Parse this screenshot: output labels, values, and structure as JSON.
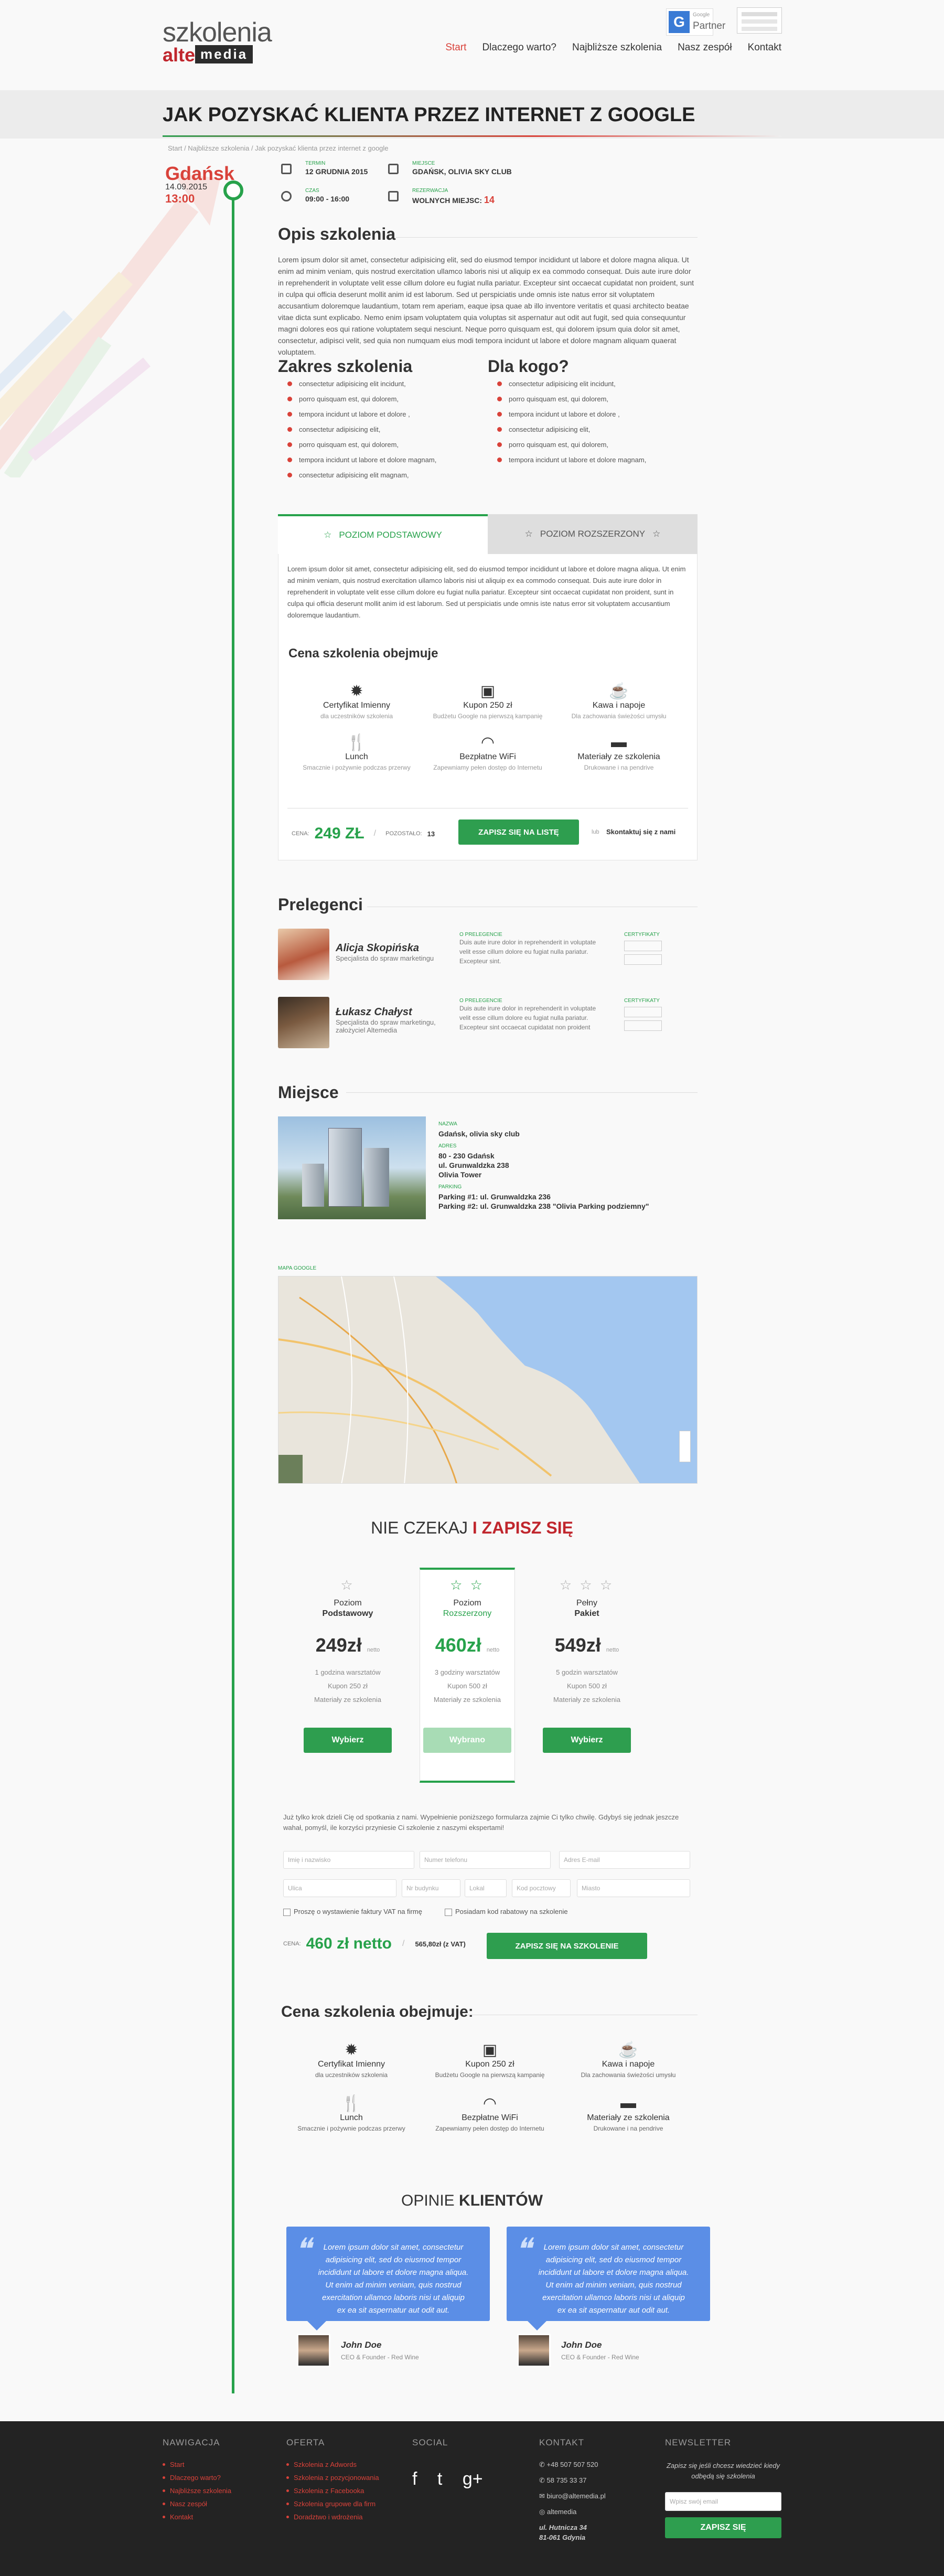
{
  "header": {
    "logo_top": "szkolenia",
    "logo_left": "alte",
    "logo_right": "media",
    "partner_letter": "G",
    "partner_small": "Google",
    "partner_label": "Partner",
    "nav": [
      "Start",
      "Dlaczego warto?",
      "Najbliższe szkolenia",
      "Nasz zespół",
      "Kontakt"
    ]
  },
  "page": {
    "title": "JAK POZYSKAĆ KLIENTA PRZEZ INTERNET Z GOOGLE",
    "breadcrumb": "Start  /  Najbliższe szkolenia  /  Jak pozyskać klienta przez internet z google"
  },
  "event": {
    "city": "Gdańsk",
    "date": "14.09.2015",
    "time": "13:00",
    "termin_label": "TERMIN",
    "termin": "12 GRUDNIA 2015",
    "miejsce_label": "MIEJSCE",
    "miejsce": "GDAŃSK, OLIVIA SKY CLUB",
    "czas_label": "CZAS",
    "czas": "09:00 - 16:00",
    "rezerwacja_label": "REZERWACJA",
    "rezerwacja": "WOLNYCH MIEJSC:",
    "wolne": "14"
  },
  "opis": {
    "title": "Opis szkolenia",
    "text": "Lorem ipsum dolor sit amet, consectetur adipisicing elit, sed do eiusmod tempor incididunt ut labore et dolore magna aliqua. Ut enim ad minim veniam, quis nostrud exercitation ullamco laboris nisi ut aliquip ex ea commodo consequat. Duis aute irure dolor in reprehenderit in voluptate velit esse cillum dolore eu fugiat nulla pariatur. Excepteur sint occaecat cupidatat non proident, sunt in culpa qui officia deserunt mollit anim id est laborum. Sed ut perspiciatis unde omnis iste natus error sit voluptatem accusantium doloremque laudantium, totam rem aperiam, eaque ipsa quae ab illo inventore veritatis et quasi architecto beatae vitae dicta sunt explicabo. Nemo enim ipsam voluptatem quia voluptas sit aspernatur aut odit aut fugit, sed quia consequuntur magni dolores eos qui ratione voluptatem sequi nesciunt. Neque porro quisquam est, qui dolorem ipsum quia dolor sit amet, consectetur, adipisci velit, sed quia non numquam eius modi tempora incidunt ut labore et dolore magnam aliquam quaerat voluptatem."
  },
  "zakres": {
    "title": "Zakres szkolenia",
    "items": [
      "consectetur adipisicing elit incidunt,",
      "porro quisquam est, qui dolorem,",
      "tempora incidunt ut labore et dolore ,",
      "consectetur adipisicing elit,",
      "porro quisquam est, qui dolorem,",
      "tempora incidunt ut labore et dolore magnam,",
      "consectetur adipisicing elit magnam,"
    ]
  },
  "dlakogo": {
    "title": "Dla kogo?",
    "items": [
      "consectetur adipisicing elit incidunt,",
      "porro quisquam est, qui dolorem,",
      "tempora incidunt ut labore et dolore ,",
      "consectetur adipisicing elit,",
      "porro quisquam est, qui dolorem,",
      "tempora incidunt ut labore et dolore magnam,"
    ]
  },
  "tabs": {
    "tab1": "POZIOM PODSTAWOWY",
    "tab2": "POZIOM ROZSZERZONY",
    "text": "Lorem ipsum dolor sit amet, consectetur adipisicing elit, sed do eiusmod tempor incididunt ut labore et dolore magna aliqua. Ut enim ad minim veniam, quis nostrud exercitation ullamco laboris nisi ut aliquip ex ea commodo consequat. Duis aute irure dolor in reprehenderit in voluptate velit esse cillum dolore eu fugiat nulla pariatur. Excepteur sint occaecat cupidatat non proident, sunt in culpa qui officia deserunt mollit anim id est laborum. Sed ut perspiciatis unde omnis iste natus error sit voluptatem accusantium doloremque laudantium.",
    "obejmuje": "Cena szkolenia obejmuje",
    "features": [
      {
        "t": "Certyfikat Imienny",
        "s": "dla uczestników szkolenia",
        "icon": "certificate-icon"
      },
      {
        "t": "Kupon 250 zł",
        "s": "Budżetu Google na pierwszą kampanię",
        "icon": "coupon-icon"
      },
      {
        "t": "Kawa i napoje",
        "s": "Dla zachowania świeżości umysłu",
        "icon": "coffee-icon"
      },
      {
        "t": "Lunch",
        "s": "Smacznie i pożywnie podczas przerwy",
        "icon": "lunch-icon"
      },
      {
        "t": "Bezpłatne WiFi",
        "s": "Zapewniamy pełen dostęp do Internetu",
        "icon": "wifi-icon"
      },
      {
        "t": "Materiały ze szkolenia",
        "s": "Drukowane i na pendrive",
        "icon": "folder-icon"
      }
    ],
    "cena_label": "CENA:",
    "cena": "249 ZŁ",
    "pozostalo_label": "POZOSTAŁO:",
    "pozostalo": "13",
    "button": "ZAPISZ SIĘ NA LISTĘ",
    "lub": "lub",
    "skontaktuj": "Skontaktuj się z nami"
  },
  "prelegenci": {
    "title": "Prelegenci",
    "o_label": "O PRELEGENCIE",
    "cert_label": "CERTYFIKATY",
    "list": [
      {
        "name": "Alicja Skopińska",
        "role": "Specjalista do spraw marketingu",
        "text": "Duis aute irure dolor in reprehenderit in voluptate velit esse cillum dolore eu fugiat nulla pariatur. Excepteur sint."
      },
      {
        "name": "Łukasz Chałyst",
        "role": "Specjalista do spraw marketingu, założyciel Altemedia",
        "text": "Duis aute irure dolor in reprehenderit in voluptate velit esse cillum dolore eu fugiat nulla pariatur. Excepteur sint occaecat cupidatat non proident"
      }
    ]
  },
  "miejsce": {
    "title": "Miejsce",
    "nazwa_label": "NAZWA",
    "nazwa": "Gdańsk, olivia sky club",
    "adres_label": "ADRES",
    "adres1": "80 - 230 Gdańsk",
    "adres2": "ul. Grunwaldzka 238",
    "adres3": "Olivia Tower",
    "parking_label": "PARKING",
    "parking1": "Parking #1: ul. Grunwaldzka 236",
    "parking2": "Parking #2: ul. Grunwaldzka 238 \"Olivia Parking podziemny\"",
    "map_label": "MAPA GOOGLE"
  },
  "pricing": {
    "title_a": "NIE CZEKAJ",
    "title_b": "I ZAPISZ SIĘ",
    "cards": [
      {
        "stars": "☆",
        "name1": "Poziom",
        "name2": "Podstawowy",
        "price": "249zł",
        "suffix": "netto",
        "f": [
          "1 godzina warsztatów",
          "Kupon 250 zł",
          "Materiały ze szkolenia"
        ],
        "button": "Wybierz"
      },
      {
        "stars": "☆ ☆",
        "name1": "Poziom",
        "name2": "Rozszerzony",
        "price": "460zł",
        "suffix": "netto",
        "f": [
          "3 godziny warsztatów",
          "Kupon 500 zł",
          "Materiały ze szkolenia"
        ],
        "button": "Wybrano"
      },
      {
        "stars": "☆ ☆ ☆",
        "name1": "Pełny",
        "name2": "Pakiet",
        "price": "549zł",
        "suffix": "netto",
        "f": [
          "5 godzin warsztatów",
          "Kupon 500 zł",
          "Materiały ze szkolenia"
        ],
        "button": "Wybierz"
      }
    ]
  },
  "form": {
    "intro": "Już tylko krok dzieli Cię od spotkania z nami. Wypełnienie poniższego formularza zajmie Ci tylko chwilę. Gdybyś się jednak jeszcze wahał, pomyśl, ile korzyści przyniesie Ci szkolenie z naszymi ekspertami!",
    "ph_name": "Imię i nazwisko",
    "ph_phone": "Numer telefonu",
    "ph_email": "Adres E-mail",
    "ph_city": "Ulica",
    "ph_street": "Nr budynku",
    "ph_no": "Lokal",
    "ph_zip": "Kod pocztowy",
    "ph_town": "Miasto",
    "cb1": "Proszę o wystawienie faktury VAT na firmę",
    "cb2": "Posiadam kod rabatowy na szkolenie",
    "cena_label": "CENA:",
    "cena": "460 zł netto",
    "slash": "/",
    "vat": "565,80zł (z VAT)",
    "button": "ZAPISZ SIĘ NA SZKOLENIE"
  },
  "obejmuje2": {
    "title": "Cena szkolenia obejmuje:"
  },
  "opinie": {
    "title_a": "OPINIE",
    "title_b": "KLIENTÓW",
    "quote_mark": "❝",
    "list": [
      {
        "text": "Lorem ipsum dolor sit amet, consectetur adipisicing elit, sed do eiusmod tempor incididunt ut labore et dolore magna aliqua. Ut enim ad minim veniam, quis nostrud exercitation ullamco laboris nisi ut aliquip ex ea sit aspernatur aut odit aut.",
        "name": "John Doe",
        "role": "CEO & Founder - Red Wine"
      },
      {
        "text": "Lorem ipsum dolor sit amet, consectetur adipisicing elit, sed do eiusmod tempor incididunt ut labore et dolore magna aliqua. Ut enim ad minim veniam, quis nostrud exercitation ullamco laboris nisi ut aliquip ex ea sit aspernatur aut odit aut.",
        "name": "John Doe",
        "role": "CEO & Founder - Red Wine"
      }
    ]
  },
  "footer": {
    "nav_title": "NAWIGACJA",
    "nav": [
      "Start",
      "Dlaczego warto?",
      "Najbliższe szkolenia",
      "Nasz zespół",
      "Kontakt"
    ],
    "oferta_title": "OFERTA",
    "oferta": [
      "Szkolenia z Adwords",
      "Szkolenia z pozycjonowania",
      "Szkolenia z Facebooka",
      "Szkolenia grupowe dla firm",
      "Doradztwo i wdrożenia"
    ],
    "social_title": "SOCIAL",
    "social": [
      "f",
      "t",
      "g+"
    ],
    "kontakt_title": "KONTAKT",
    "kontakt": [
      "+48 507 507 520",
      "58 735 33 37",
      "biuro@altemedia.pl",
      "altemedia",
      "ul. Hutnicza 34",
      "81-061 Gdynia"
    ],
    "news_title": "NEWSLETTER",
    "news_text": "Zapisz się jeśli chcesz wiedzieć kiedy odbędą się szkolenia",
    "news_ph": "Wpisz swój email",
    "news_btn": "ZAPISZ SIĘ"
  }
}
